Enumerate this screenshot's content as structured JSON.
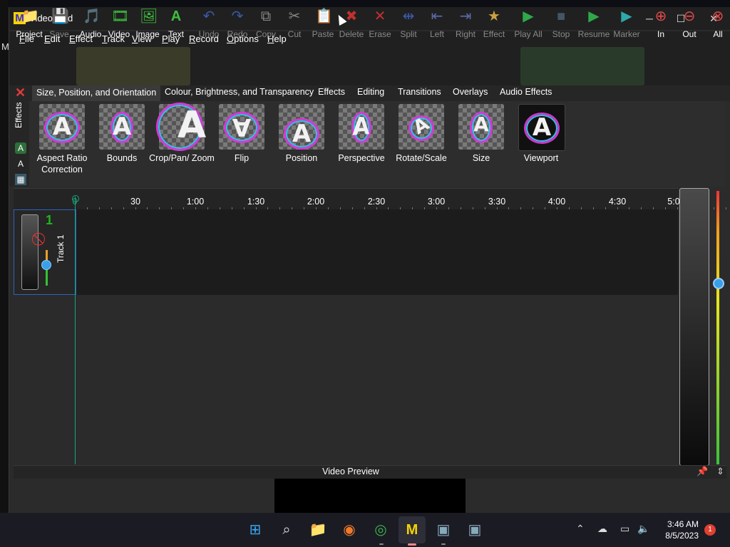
{
  "window": {
    "title": "VideoMeld",
    "logo_letter": "M",
    "desktop_letter": "M"
  },
  "menu": [
    "File",
    "Edit",
    "Effect",
    "Track",
    "View",
    "Play",
    "Record",
    "Options",
    "Help"
  ],
  "toolbar": [
    {
      "label": "Project",
      "icon": "project-icon",
      "glyph": "📁"
    },
    {
      "label": "Save",
      "icon": "save-icon",
      "glyph": "💾"
    },
    {
      "label": "Audio",
      "icon": "add-audio-icon",
      "glyph": "🎵"
    },
    {
      "label": "Video",
      "icon": "add-video-icon",
      "glyph": "🎞"
    },
    {
      "label": "Image",
      "icon": "add-image-icon",
      "glyph": "🖼"
    },
    {
      "label": "Text",
      "icon": "add-text-icon",
      "glyph": "A"
    },
    {
      "label": "Undo",
      "icon": "undo-icon",
      "glyph": "↶"
    },
    {
      "label": "Redo",
      "icon": "redo-icon",
      "glyph": "↷"
    },
    {
      "label": "Copy",
      "icon": "copy-icon",
      "glyph": "⧉"
    },
    {
      "label": "Cut",
      "icon": "cut-icon",
      "glyph": "✂"
    },
    {
      "label": "Paste",
      "icon": "paste-icon",
      "glyph": "📋"
    },
    {
      "label": "Delete",
      "icon": "delete-icon",
      "glyph": "✖"
    },
    {
      "label": "Erase",
      "icon": "erase-icon",
      "glyph": "✕"
    },
    {
      "label": "Split",
      "icon": "split-icon",
      "glyph": "⇹"
    },
    {
      "label": "Left",
      "icon": "move-left-icon",
      "glyph": "⇤"
    },
    {
      "label": "Right",
      "icon": "move-right-icon",
      "glyph": "⇥"
    },
    {
      "label": "Effect",
      "icon": "effect-star-icon",
      "glyph": "★"
    },
    {
      "label": "Play All",
      "icon": "play-icon",
      "glyph": "▶"
    },
    {
      "label": "Stop",
      "icon": "stop-icon",
      "glyph": "■"
    },
    {
      "label": "Resume",
      "icon": "resume-icon",
      "glyph": "▶"
    },
    {
      "label": "Marker",
      "icon": "marker-icon",
      "glyph": "▶"
    },
    {
      "label": "In",
      "icon": "zoom-in-icon",
      "glyph": "⊕"
    },
    {
      "label": "Out",
      "icon": "zoom-out-icon",
      "glyph": "⊖"
    },
    {
      "label": "All",
      "icon": "zoom-all-icon",
      "glyph": "⊗"
    }
  ],
  "tabs": [
    "Size, Position, and Orientation",
    "Colour, Brightness, and Transparency",
    "Effects",
    "Editing",
    "Transitions",
    "Overlays",
    "Audio Effects"
  ],
  "effects_side_label": "Effects",
  "effects": [
    {
      "label": "Aspect Ratio Correction"
    },
    {
      "label": "Bounds"
    },
    {
      "label": "Crop/Pan/ Zoom"
    },
    {
      "label": "Flip"
    },
    {
      "label": "Position"
    },
    {
      "label": "Perspective"
    },
    {
      "label": "Rotate/Scale"
    },
    {
      "label": "Size"
    },
    {
      "label": "Viewport"
    }
  ],
  "thumb_letter": "A",
  "timeline": {
    "ticks": [
      "0",
      "30",
      "1:00",
      "1:30",
      "2:00",
      "2:30",
      "3:00",
      "3:30",
      "4:00",
      "4:30",
      "5:0"
    ]
  },
  "track": {
    "number": "1",
    "label": "Track 1"
  },
  "preview": {
    "title": "Video Preview"
  },
  "taskbar": {
    "time": "3:46 AM",
    "date": "8/5/2023",
    "notifications": "1"
  },
  "colors": {
    "accent_green": "#19a37b",
    "track_border": "#2b64c2"
  }
}
